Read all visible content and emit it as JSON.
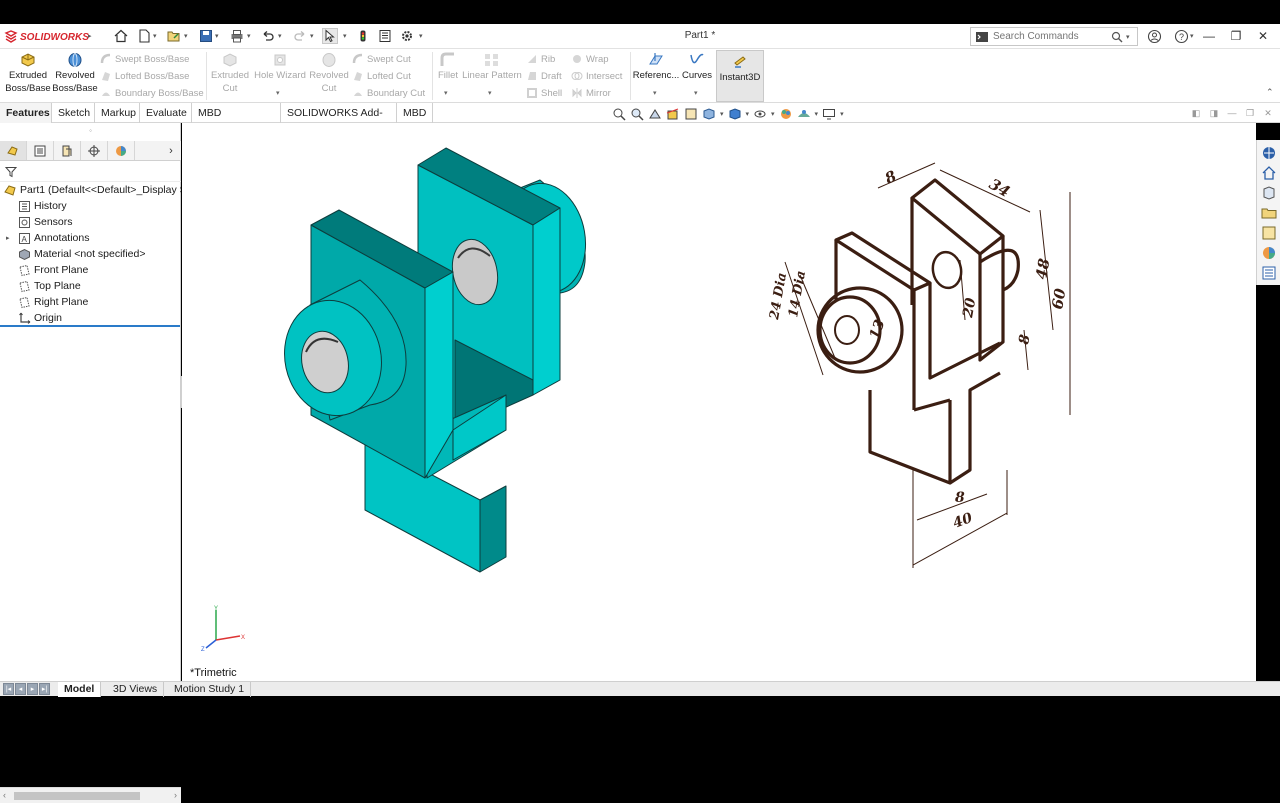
{
  "app": {
    "brand": "SOLIDWORKS",
    "document_title": "Part1 *"
  },
  "search": {
    "placeholder": "Search Commands"
  },
  "ribbon": {
    "extruded_boss": "Extruded Boss/Base",
    "revolved_boss": "Revolved Boss/Base",
    "swept_boss": "Swept Boss/Base",
    "lofted_boss": "Lofted Boss/Base",
    "boundary_boss": "Boundary Boss/Base",
    "extruded_cut": "Extruded Cut",
    "hole_wizard": "Hole Wizard",
    "revolved_cut": "Revolved Cut",
    "swept_cut": "Swept Cut",
    "lofted_cut": "Lofted Cut",
    "boundary_cut": "Boundary Cut",
    "fillet": "Fillet",
    "linear_pattern": "Linear Pattern",
    "rib": "Rib",
    "draft": "Draft",
    "shell": "Shell",
    "wrap": "Wrap",
    "intersect": "Intersect",
    "mirror": "Mirror",
    "reference": "Referenc...",
    "curves": "Curves",
    "instant3d": "Instant3D"
  },
  "tabs": [
    "Features",
    "Sketch",
    "Markup",
    "Evaluate",
    "MBD Dimensions",
    "SOLIDWORKS Add-Ins",
    "MBD"
  ],
  "tree": {
    "part": "Part1  (Default<<Default>_Display S",
    "items": [
      "History",
      "Sensors",
      "Annotations",
      "Material <not specified>",
      "Front Plane",
      "Top Plane",
      "Right Plane",
      "Origin"
    ]
  },
  "viewport": {
    "view_label": "*Trimetric"
  },
  "drawing": {
    "dims": [
      "8",
      "34",
      "48",
      "60",
      "24 Dia",
      "14 Dia",
      "13",
      "20",
      "8",
      "8",
      "40"
    ]
  },
  "bottom_tabs": [
    "Model",
    "3D Views",
    "Motion Study 1"
  ],
  "colors": {
    "model_light": "#00c8c8",
    "model_dark": "#007a7a",
    "brand_red": "#d6262e",
    "drawing_ink": "#3b1e12"
  }
}
